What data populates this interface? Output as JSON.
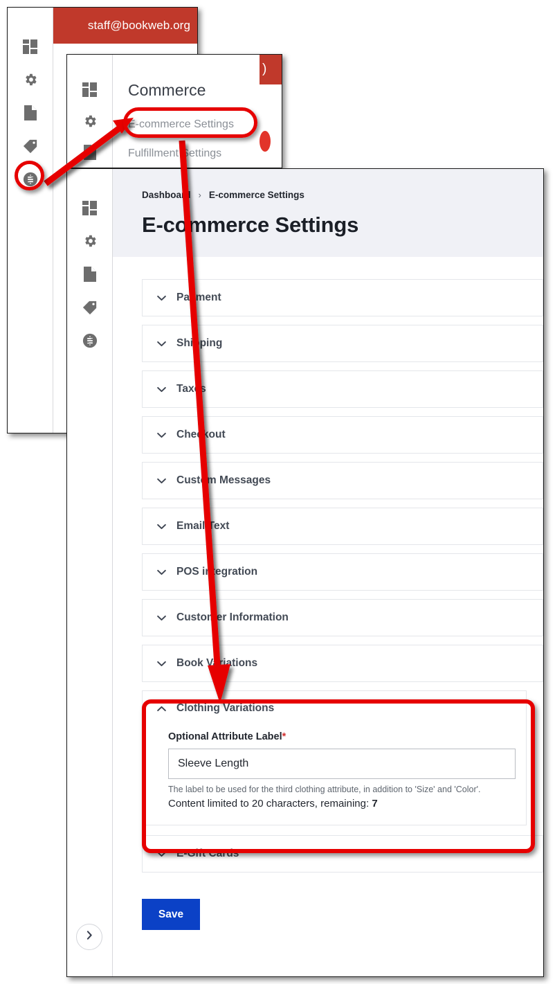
{
  "top_window": {
    "account_bar": {
      "email": "staff@bookweb.org"
    },
    "rail_icons": [
      "dashboard-grid-icon",
      "gear-icon",
      "page-icon",
      "tag-icon",
      "dollar-circle-icon"
    ]
  },
  "commerce_menu": {
    "title": "Commerce",
    "rail_icons": [
      "dashboard-grid-icon",
      "gear-icon",
      "page-icon"
    ],
    "items": [
      {
        "label": "E-commerce Settings",
        "highlighted": true
      },
      {
        "label": "Fulfillment Settings",
        "highlighted": false
      }
    ]
  },
  "main_window": {
    "rail_icons": [
      "dashboard-grid-icon",
      "gear-icon",
      "page-icon",
      "tag-icon",
      "dollar-circle-icon"
    ],
    "collapse_toggle": "chevron-right-icon",
    "breadcrumb": {
      "root": "Dashboard",
      "separator": "›",
      "current": "E-commerce Settings"
    },
    "page_title": "E-commerce Settings",
    "sections": [
      {
        "label": "Payment",
        "expanded": false
      },
      {
        "label": "Shipping",
        "expanded": false
      },
      {
        "label": "Taxes",
        "expanded": false
      },
      {
        "label": "Checkout",
        "expanded": false
      },
      {
        "label": "Custom Messages",
        "expanded": false
      },
      {
        "label": "Email Text",
        "expanded": false
      },
      {
        "label": "POS integration",
        "expanded": false
      },
      {
        "label": "Customer Information",
        "expanded": false
      },
      {
        "label": "Book Variations",
        "expanded": false
      }
    ],
    "clothing_section": {
      "label": "Clothing Variations",
      "expanded": true,
      "field": {
        "label": "Optional Attribute Label",
        "required_marker": "*",
        "value": "Sleeve Length",
        "placeholder": "",
        "help_text": "The label to be used for the third clothing attribute, in addition to 'Size' and 'Color'.",
        "counter_prefix": "Content limited to 20 characters, remaining:",
        "counter_remaining": "7"
      }
    },
    "trailing_section": {
      "label": "E-Gift Cards",
      "expanded": false
    },
    "save_label": "Save"
  },
  "colors": {
    "brand_red": "#c0392b",
    "annotation_red": "#e60000",
    "save_blue": "#0b41c6",
    "header_bg": "#f0f1f6",
    "required_red": "#d03030"
  }
}
